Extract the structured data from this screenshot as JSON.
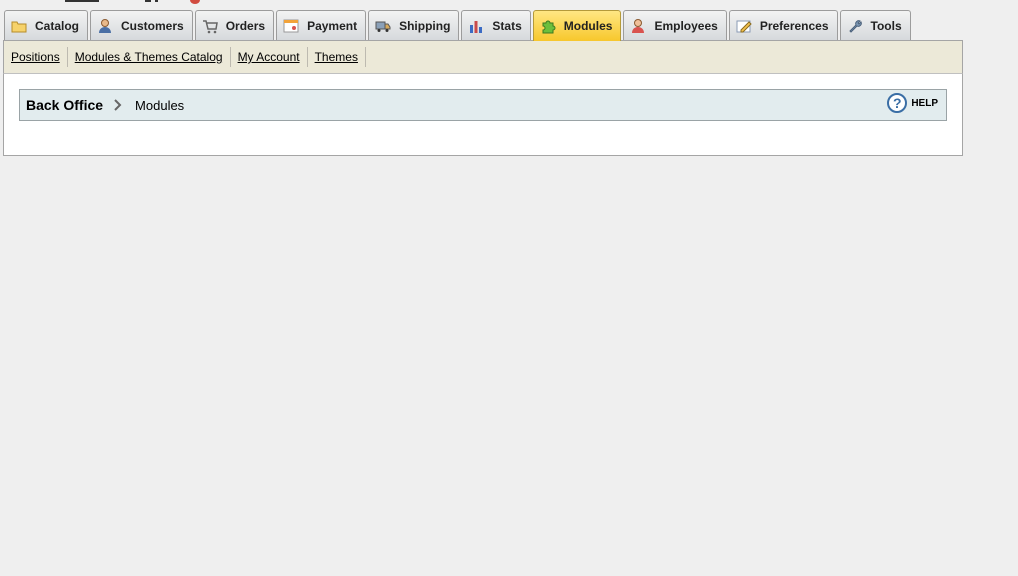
{
  "tabs": [
    {
      "label": "Catalog",
      "icon": "folder-icon",
      "active": false
    },
    {
      "label": "Customers",
      "icon": "customer-icon",
      "active": false
    },
    {
      "label": "Orders",
      "icon": "cart-icon",
      "active": false
    },
    {
      "label": "Payment",
      "icon": "payment-icon",
      "active": false
    },
    {
      "label": "Shipping",
      "icon": "truck-icon",
      "active": false
    },
    {
      "label": "Stats",
      "icon": "bar-chart-icon",
      "active": false
    },
    {
      "label": "Modules",
      "icon": "puzzle-icon",
      "active": true
    },
    {
      "label": "Employees",
      "icon": "employee-icon",
      "active": false
    },
    {
      "label": "Preferences",
      "icon": "preferences-icon",
      "active": false
    },
    {
      "label": "Tools",
      "icon": "wrench-icon",
      "active": false
    }
  ],
  "subtabs": [
    "Positions",
    "Modules & Themes Catalog",
    "My Account",
    "Themes"
  ],
  "breadcrumb": {
    "home": "Back Office",
    "current": "Modules"
  },
  "help": {
    "label": "HELP",
    "icon": "help-icon",
    "symbol": "?"
  },
  "colors": {
    "active_tab": "#f7c72c",
    "subbar": "#ece9d8",
    "breadcrumb_bg": "#e2ecee",
    "help": "#3a6ea5"
  }
}
